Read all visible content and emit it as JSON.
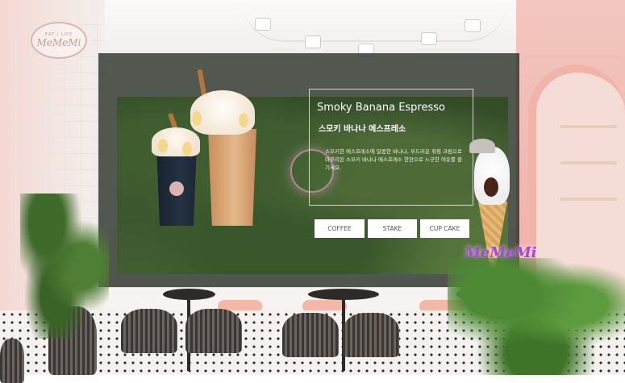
{
  "brand": {
    "logo_top": "EAT / LIFE",
    "logo_name": "MeMeMi",
    "logo_bottom": "",
    "neon_sign": "MeMeMi"
  },
  "info": {
    "title_en": "Smoky Banana Espresso",
    "title_ko": "스모키 바나나 에스프레소",
    "description": "스모키한 에스프레소에 달콤한 바나나, 부드러운 휘핑 크림으로 마무리된 스모키 바나나 에스프레소 한잔으로 느긋한 여유를 즐기세요."
  },
  "menu": {
    "coffee": "COFFEE",
    "stake": "STAKE",
    "cupcake": "CUP CAKE"
  },
  "colors": {
    "overlay": "#1c2416",
    "button_bg": "#ffffff",
    "neon": "#a846d6",
    "wall_pink": "#f0b3aa"
  }
}
